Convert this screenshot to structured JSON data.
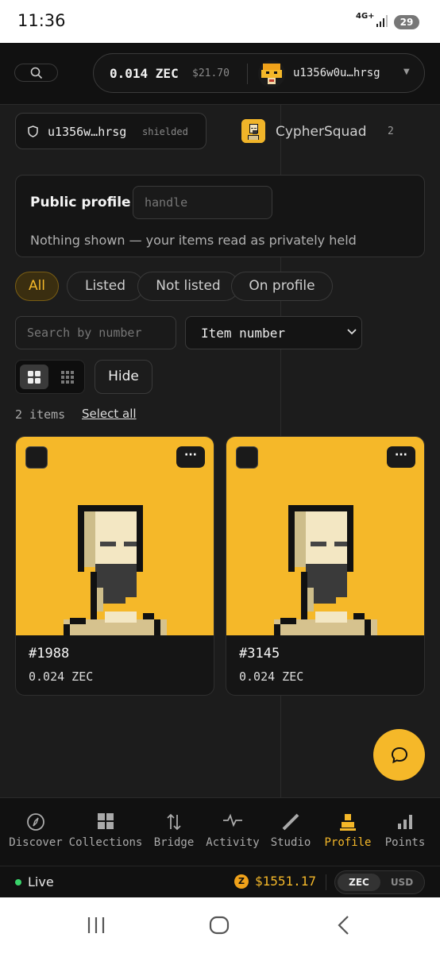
{
  "status": {
    "time": "11:36",
    "network": "4G+",
    "battery": "29"
  },
  "wallet": {
    "balance": "0.014 ZEC",
    "usd": "$21.70",
    "address": "u1356w0u…hrsg"
  },
  "account": {
    "address": "u1356w…hrsg",
    "tag": "shielded"
  },
  "collection": {
    "name": "CypherSquad",
    "count": "2"
  },
  "profile": {
    "label": "Public profile",
    "handle_placeholder": "handle",
    "note": "Nothing shown — your items read as privately held"
  },
  "filters": [
    "All",
    "Listed",
    "Not listed",
    "On profile"
  ],
  "search": {
    "placeholder": "Search by number"
  },
  "sort": {
    "value": "Item number"
  },
  "hide_label": "Hide",
  "items_count": "2 items",
  "select_all": "Select all",
  "items": [
    {
      "number": "#1988",
      "price": "0.024 ZEC",
      "more": "···"
    },
    {
      "number": "#3145",
      "price": "0.024 ZEC",
      "more": "···"
    }
  ],
  "nav": [
    {
      "label": "Discover",
      "icon": "compass-icon"
    },
    {
      "label": "Collections",
      "icon": "grid-icon"
    },
    {
      "label": "Bridge",
      "icon": "arrows-updown-icon"
    },
    {
      "label": "Activity",
      "icon": "pulse-icon"
    },
    {
      "label": "Studio",
      "icon": "pen-icon"
    },
    {
      "label": "Profile",
      "icon": "user-icon"
    },
    {
      "label": "Points",
      "icon": "bar-chart-icon"
    }
  ],
  "live": {
    "label": "Live",
    "price": "$1551.17",
    "coin": "Z",
    "currencies": [
      "ZEC",
      "USD"
    ]
  },
  "colors": {
    "accent": "#f5b829",
    "bg": "#1c1c1c",
    "live": "#39d36a"
  }
}
